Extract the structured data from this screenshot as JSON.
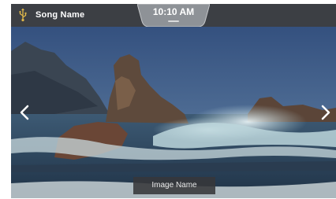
{
  "topbar": {
    "song_name": "Song Name",
    "usb_icon": "usb-icon",
    "time": "10:10 AM"
  },
  "photo": {
    "image_name": "Image Name"
  },
  "nav": {
    "prev_icon": "chevron-left-icon",
    "next_icon": "chevron-right-icon"
  },
  "colors": {
    "topbar_bg": "#3c3f44",
    "clock_tab_bg": "#8e9297",
    "text": "#ffffff",
    "caption_bg": "#37373a"
  }
}
